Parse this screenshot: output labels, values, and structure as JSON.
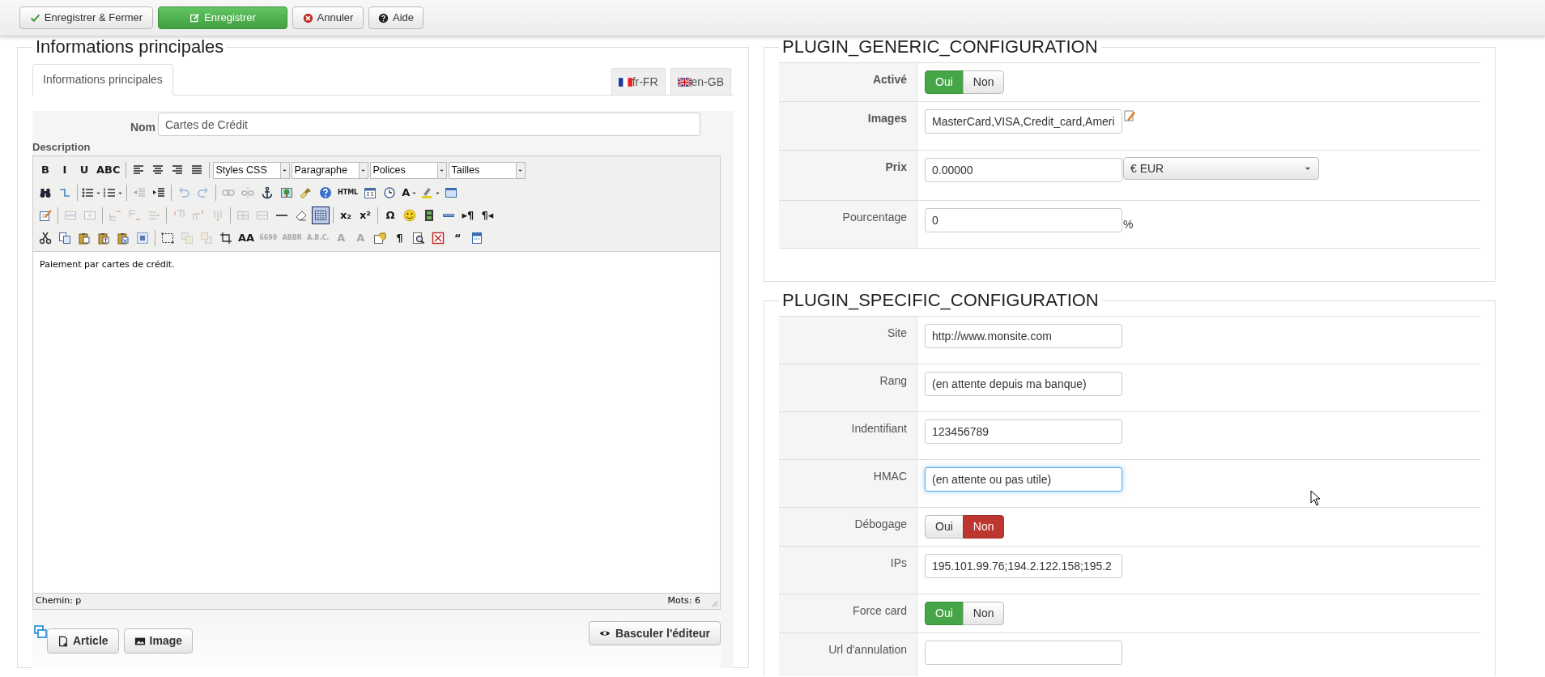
{
  "toolbar": {
    "buttons": [
      {
        "label": "Enregistrer & Fermer",
        "kind": "save_close"
      },
      {
        "label": "Enregistrer",
        "kind": "primary"
      },
      {
        "label": "Annuler",
        "kind": "cancel"
      },
      {
        "label": "Aide",
        "kind": "help"
      }
    ]
  },
  "main_info": {
    "title": "Informations principales",
    "tabs": [
      {
        "label": "Informations principales",
        "selected": true
      }
    ],
    "languages": [
      {
        "label": "fr-FR",
        "kind": "fr"
      },
      {
        "label": "en-GB",
        "kind": "gb"
      }
    ],
    "name_field": {
      "label": "Nom",
      "value": "Cartes de Crédit"
    },
    "description": {
      "label": "Description",
      "toolbar_rows": [
        [
          {
            "kind": "glyph",
            "text": "B"
          },
          {
            "kind": "glyph",
            "text": "I"
          },
          {
            "kind": "glyph",
            "text": "U"
          },
          {
            "kind": "glyph",
            "text": "ABC"
          },
          {
            "kind": "separator"
          },
          {
            "kind": "icon"
          },
          {
            "kind": "icon"
          },
          {
            "kind": "icon"
          },
          {
            "kind": "icon"
          },
          {
            "kind": "separator"
          },
          {
            "kind": "select",
            "text": "Styles CSS"
          },
          {
            "kind": "select",
            "text": "Paragraphe"
          },
          {
            "kind": "select",
            "text": "Polices"
          },
          {
            "kind": "select",
            "text": "Tailles"
          }
        ],
        [
          {
            "kind": "icon"
          },
          {
            "kind": "icon"
          },
          {
            "kind": "separator"
          },
          {
            "kind": "icon_menu"
          },
          {
            "kind": "icon_menu"
          },
          {
            "kind": "separator"
          },
          {
            "kind": "icon_off"
          },
          {
            "kind": "icon"
          },
          {
            "kind": "separator"
          },
          {
            "kind": "icon_off"
          },
          {
            "kind": "icon_off"
          },
          {
            "kind": "separator"
          },
          {
            "kind": "icon_off"
          },
          {
            "kind": "icon_off"
          },
          {
            "kind": "icon"
          },
          {
            "kind": "icon"
          },
          {
            "kind": "icon"
          },
          {
            "kind": "icon"
          },
          {
            "kind": "glyph",
            "text": "HTML"
          },
          {
            "kind": "icon"
          },
          {
            "kind": "icon"
          },
          {
            "kind": "glyph_menu",
            "text": "A"
          },
          {
            "kind": "icon_menu"
          },
          {
            "kind": "icon"
          }
        ],
        [
          {
            "kind": "icon"
          },
          {
            "kind": "separator"
          },
          {
            "kind": "icon_off"
          },
          {
            "kind": "icon_off"
          },
          {
            "kind": "separator"
          },
          {
            "kind": "icon_off"
          },
          {
            "kind": "icon_off"
          },
          {
            "kind": "icon_off"
          },
          {
            "kind": "separator"
          },
          {
            "kind": "icon_off"
          },
          {
            "kind": "icon_off"
          },
          {
            "kind": "icon_off"
          },
          {
            "kind": "separator"
          },
          {
            "kind": "icon_off"
          },
          {
            "kind": "icon_off"
          },
          {
            "kind": "icon"
          },
          {
            "kind": "icon"
          },
          {
            "kind": "icon_on"
          },
          {
            "kind": "separator"
          },
          {
            "kind": "glyph",
            "text": "x₂"
          },
          {
            "kind": "glyph",
            "text": "x²"
          },
          {
            "kind": "separator"
          },
          {
            "kind": "glyph",
            "text": "Ω"
          },
          {
            "kind": "icon"
          },
          {
            "kind": "icon"
          },
          {
            "kind": "icon"
          },
          {
            "kind": "glyph",
            "text": "▸¶"
          },
          {
            "kind": "glyph",
            "text": "¶◂"
          }
        ],
        [
          {
            "kind": "icon"
          },
          {
            "kind": "icon"
          },
          {
            "kind": "icon"
          },
          {
            "kind": "icon"
          },
          {
            "kind": "icon"
          },
          {
            "kind": "icon"
          },
          {
            "kind": "separator"
          },
          {
            "kind": "icon"
          },
          {
            "kind": "icon_off"
          },
          {
            "kind": "icon_off"
          },
          {
            "kind": "icon"
          },
          {
            "kind": "glyph",
            "text": "AA"
          },
          {
            "kind": "glyph_off",
            "text": "6699"
          },
          {
            "kind": "glyph_off",
            "text": "ABBR"
          },
          {
            "kind": "glyph_off",
            "text": "A.B.C."
          },
          {
            "kind": "glyph_off",
            "text": "A"
          },
          {
            "kind": "glyph_off",
            "text": "A"
          },
          {
            "kind": "icon"
          },
          {
            "kind": "glyph",
            "text": "¶"
          },
          {
            "kind": "icon"
          },
          {
            "kind": "icon"
          },
          {
            "kind": "glyph",
            "text": "“"
          },
          {
            "kind": "icon"
          }
        ]
      ],
      "content": "Paiement par cartes de crédit.",
      "path": "Chemin: p",
      "word_count": "Mots: 6"
    },
    "buttons": [
      {
        "label": "Article",
        "kind": "article"
      },
      {
        "label": "Image",
        "kind": "image"
      }
    ],
    "toggle_button": "Basculer l'éditeur"
  },
  "generic_config": {
    "title": "PLUGIN_GENERIC_CONFIGURATION",
    "rows": [
      {
        "label": "Activé",
        "emphasized": true,
        "kind": "toggle",
        "options": [
          {
            "label": "Oui",
            "selected": true
          },
          {
            "label": "Non",
            "selected": false
          }
        ]
      },
      {
        "label": "Images",
        "emphasized": true,
        "kind": "text_edit",
        "value": "MasterCard,VISA,Credit_card,Ameri",
        "focused": false
      },
      {
        "label": "Prix",
        "emphasized": true,
        "kind": "price",
        "value": "0.00000",
        "currency": "€ EUR",
        "focused": false
      },
      {
        "label": "Pourcentage",
        "emphasized": false,
        "kind": "percent",
        "value": "0",
        "suffix": "%",
        "focused": false
      }
    ]
  },
  "specific_config": {
    "title": "PLUGIN_SPECIFIC_CONFIGURATION",
    "rows": [
      {
        "label": "Site",
        "emphasized": false,
        "kind": "text",
        "value": "http://www.monsite.com",
        "focused": false
      },
      {
        "label": "Rang",
        "emphasized": false,
        "kind": "text",
        "value": "(en attente depuis ma banque)",
        "focused": false
      },
      {
        "label": "Indentifiant",
        "emphasized": false,
        "kind": "text",
        "value": "123456789",
        "focused": false
      },
      {
        "label": "HMAC",
        "emphasized": false,
        "kind": "text",
        "value": "(en attente ou pas utile)",
        "focused": true
      },
      {
        "label": "Débogage",
        "emphasized": false,
        "kind": "toggle",
        "options": [
          {
            "label": "Oui",
            "selected": false
          },
          {
            "label": "Non",
            "selected": true
          }
        ]
      },
      {
        "label": "IPs",
        "emphasized": false,
        "kind": "text",
        "value": "195.101.99.76;194.2.122.158;195.2",
        "focused": false
      },
      {
        "label": "Force card",
        "emphasized": false,
        "kind": "toggle",
        "options": [
          {
            "label": "Oui",
            "selected": true
          },
          {
            "label": "Non",
            "selected": false
          }
        ]
      },
      {
        "label": "Url d'annulation",
        "emphasized": false,
        "kind": "text",
        "focused": false
      }
    ]
  }
}
